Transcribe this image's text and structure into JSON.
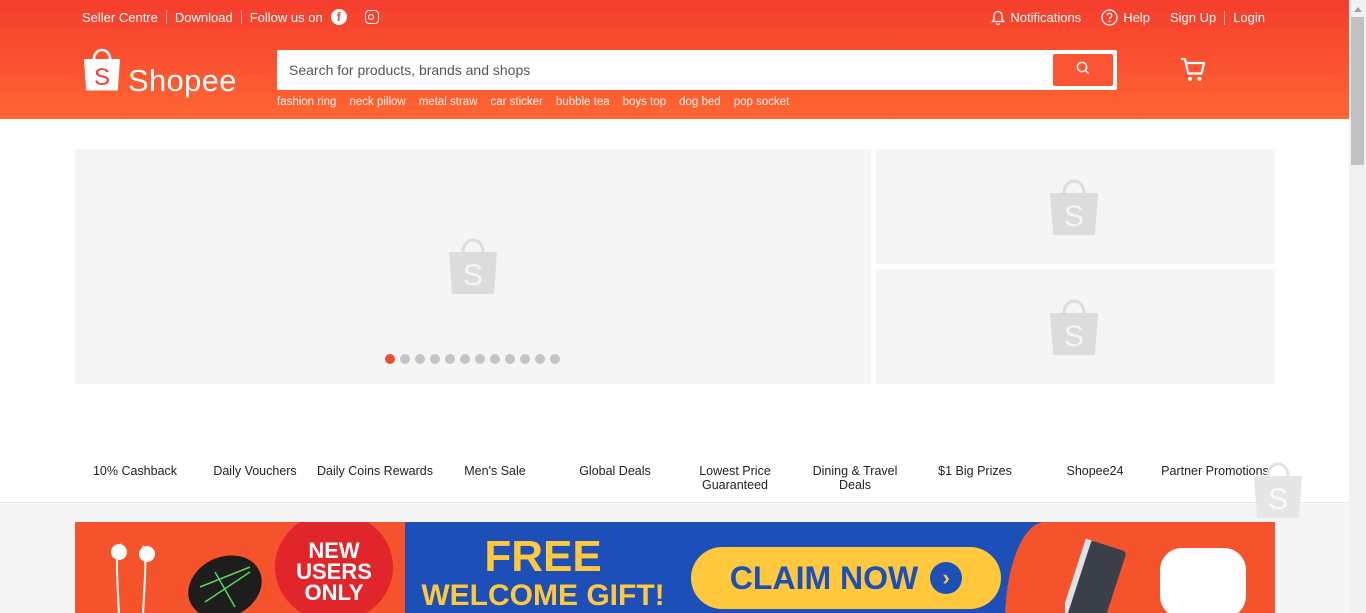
{
  "topbar": {
    "seller_centre": "Seller Centre",
    "download": "Download",
    "follow_us": "Follow us on",
    "notifications": "Notifications",
    "help": "Help",
    "sign_up": "Sign Up",
    "login": "Login"
  },
  "brand": {
    "logo_text": "Shopee"
  },
  "search": {
    "placeholder": "Search for products, brands and shops",
    "suggestions": [
      "fashion ring",
      "neck pillow",
      "metal straw",
      "car sticker",
      "bubble tea",
      "boys top",
      "dog bed",
      "pop socket"
    ]
  },
  "carousel": {
    "slide_count": 12,
    "active_index": 0
  },
  "quick_links": [
    "10% Cashback",
    "Daily Vouchers",
    "Daily Coins Rewards",
    "Men's Sale",
    "Global Deals",
    "Lowest Price Guaranteed",
    "Dining & Travel Deals",
    "$1 Big Prizes",
    "Shopee24",
    "Partner Promotions"
  ],
  "promo": {
    "badge_line1": "NEW",
    "badge_line2": "USERS",
    "badge_line3": "ONLY",
    "headline": "FREE",
    "subheadline": "WELCOME GIFT!",
    "cta": "CLAIM NOW"
  },
  "colors": {
    "brand_orange": "#f53d2d",
    "brand_orange_light": "#ff6633",
    "search_button": "#fb5533",
    "carousel_active": "#ee4d2d",
    "promo_blue": "#1c50b8",
    "promo_yellow": "#ffc83d"
  }
}
